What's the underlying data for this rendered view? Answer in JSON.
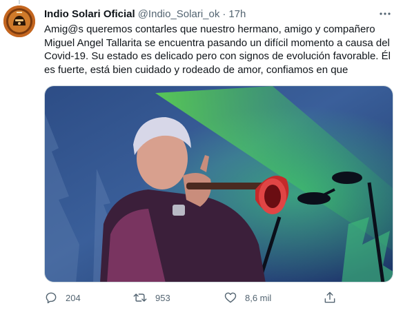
{
  "tweet": {
    "display_name": "Indio Solari Oficial",
    "handle": "@Indio_Solari_ok",
    "separator": "·",
    "time": "17h",
    "text": "Amig@s queremos contarles que nuestro hermano, amigo y compañero Miguel Angel Tallarita se encuentra pasando un difícil momento a causa del Covid-19. Su estado es delicado pero con signos de evolución favorable. Él es fuerte, está bien cuidado y rodeado de amor, confiamos en que",
    "avatar_icon": "avatar-logo",
    "more_icon": "more-dots-icon",
    "media": {
      "description_icon": "photo-trumpet-player"
    }
  },
  "actions": {
    "reply": {
      "icon": "reply-icon",
      "count": "204"
    },
    "retweet": {
      "icon": "retweet-icon",
      "count": "953"
    },
    "like": {
      "icon": "heart-icon",
      "count": "8,6 mil"
    },
    "share": {
      "icon": "share-icon"
    }
  },
  "colors": {
    "text": "#0f1419",
    "secondary": "#536471",
    "border": "#cfd9de",
    "avatar": "#c4661f"
  }
}
